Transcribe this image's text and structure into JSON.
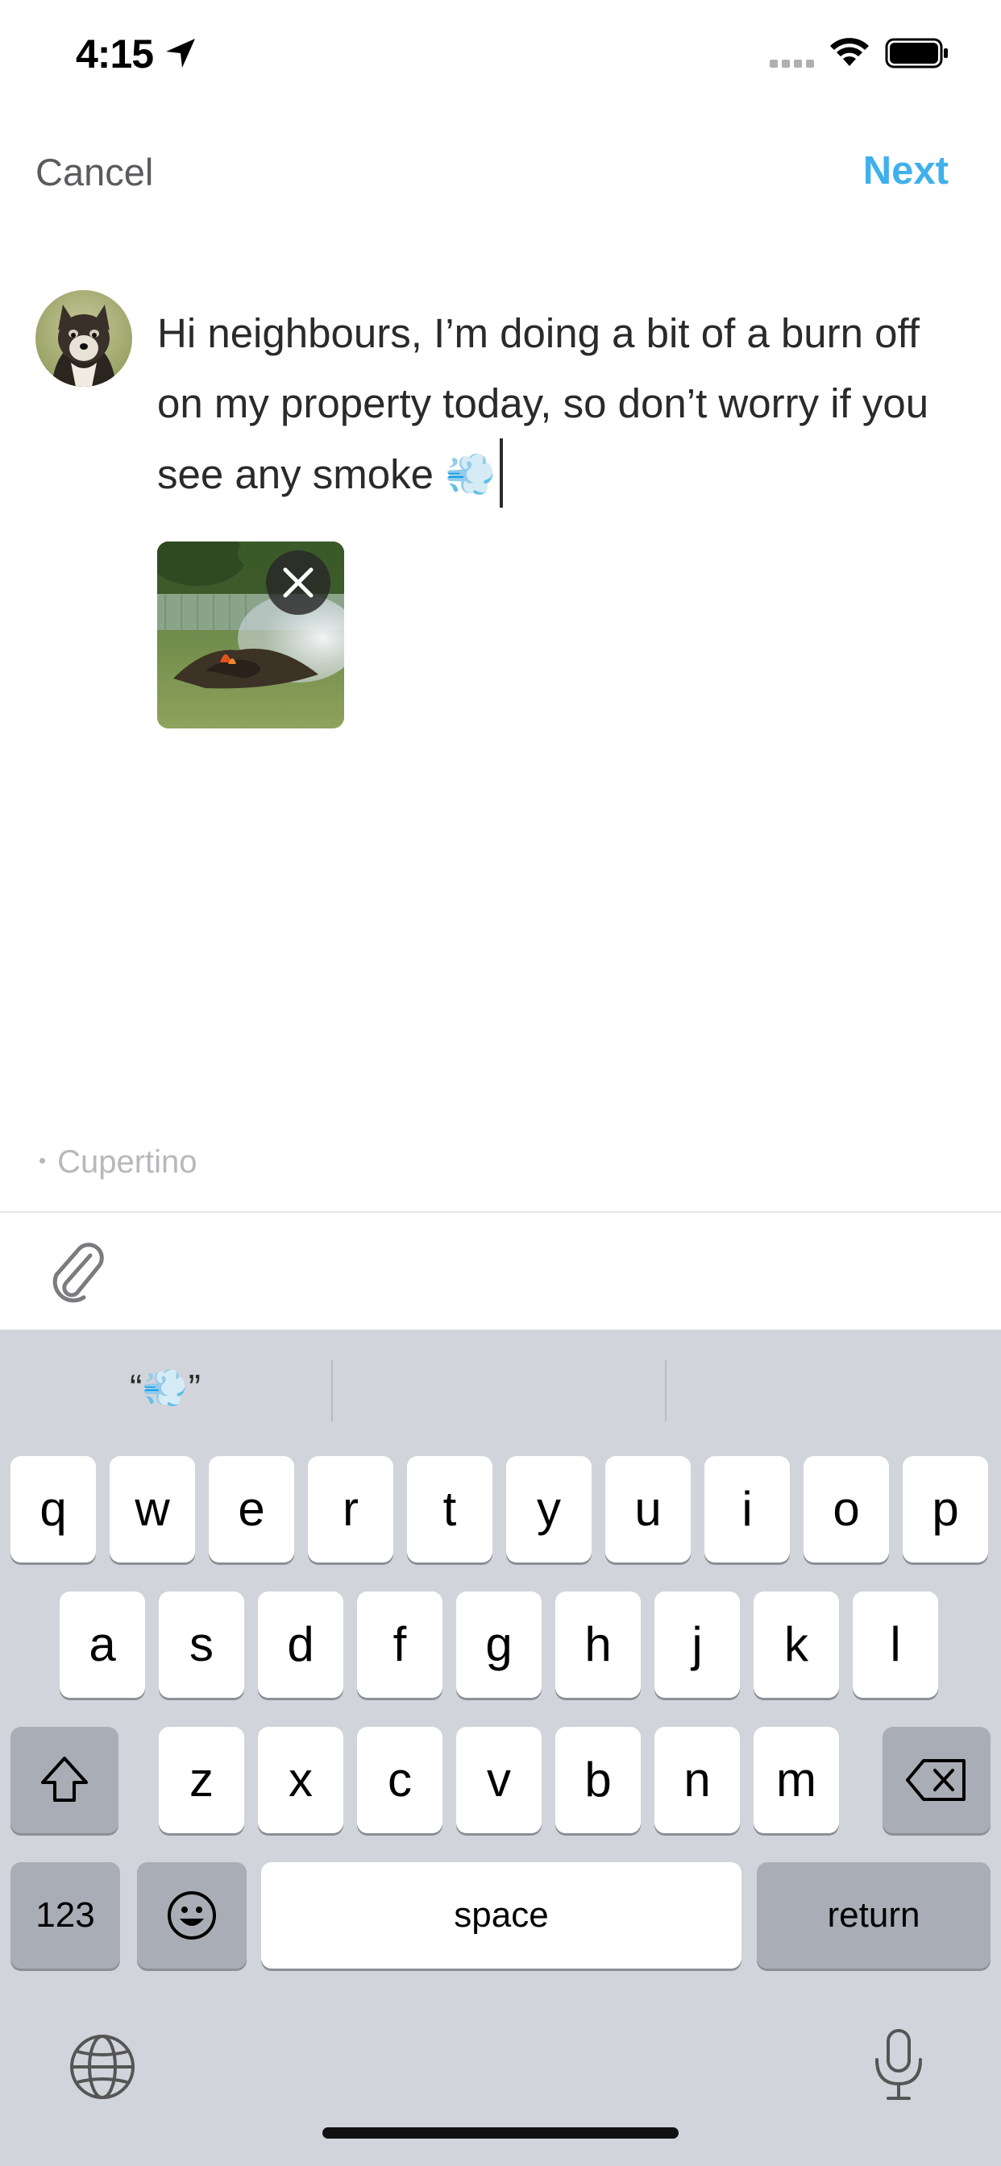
{
  "status_bar": {
    "time": "4:15"
  },
  "nav": {
    "cancel_label": "Cancel",
    "next_label": "Next"
  },
  "composer": {
    "text": "Hi neighbours, I’m doing a bit of a burn off on my property today, so don’t worry if you see any smoke 💨",
    "location": "Cupertino"
  },
  "keyboard": {
    "suggestions": [
      "“💨”",
      "",
      ""
    ],
    "row1": [
      "q",
      "w",
      "e",
      "r",
      "t",
      "y",
      "u",
      "i",
      "o",
      "p"
    ],
    "row2": [
      "a",
      "s",
      "d",
      "f",
      "g",
      "h",
      "j",
      "k",
      "l"
    ],
    "row3": [
      "z",
      "x",
      "c",
      "v",
      "b",
      "n",
      "m"
    ],
    "numbers_label": "123",
    "space_label": "space",
    "return_label": "return"
  },
  "colors": {
    "accent": "#3fb0ec",
    "keyboard_bg": "#d1d4da"
  },
  "icons": [
    "location-arrow-icon",
    "signal-icon",
    "wifi-icon",
    "battery-icon",
    "close-icon",
    "paperclip-icon",
    "shift-icon",
    "delete-icon",
    "emoji-icon",
    "globe-icon",
    "microphone-icon"
  ]
}
